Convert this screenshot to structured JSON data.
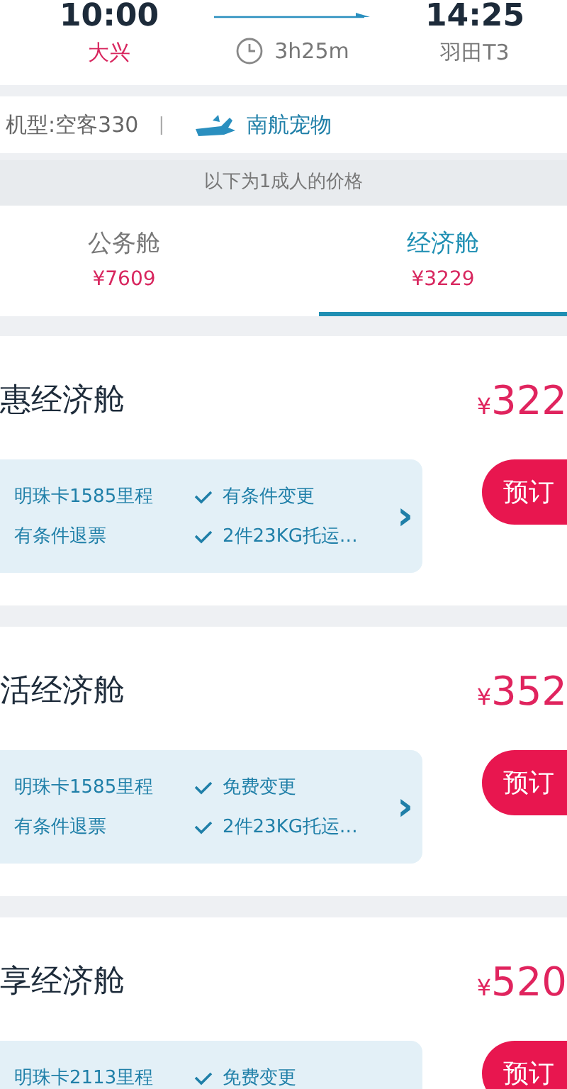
{
  "flight": {
    "depart_time": "10:00",
    "depart_airport": "大兴",
    "duration": "3h25m",
    "arrive_time": "14:25",
    "arrive_airport": "羽田T3"
  },
  "info": {
    "aircraft": "机型:空客330",
    "separator": "|",
    "pet_service": "南航宠物"
  },
  "price_note": "以下为1成人的价格",
  "tabs": [
    {
      "label": "公务舱",
      "price": "¥7609",
      "selected": false
    },
    {
      "label": "经济舱",
      "price": "¥3229",
      "selected": true
    }
  ],
  "fares": [
    {
      "name": "惠经济舱",
      "currency": "¥",
      "price": "322",
      "button": "预订",
      "perks": [
        {
          "left": "明珠卡1585里程",
          "right": "有条件变更"
        },
        {
          "left": "有条件退票",
          "right": "2件23KG托运…"
        }
      ],
      "more": "›"
    },
    {
      "name": "活经济舱",
      "currency": "¥",
      "price": "352",
      "button": "预订",
      "perks": [
        {
          "left": "明珠卡1585里程",
          "right": "免费变更"
        },
        {
          "left": "有条件退票",
          "right": "2件23KG托运…"
        }
      ],
      "more": "›"
    },
    {
      "name": "享经济舱",
      "currency": "¥",
      "price": "520",
      "button": "预订",
      "perks": [
        {
          "left": "明珠卡2113里程",
          "right": "免费变更"
        }
      ]
    }
  ]
}
